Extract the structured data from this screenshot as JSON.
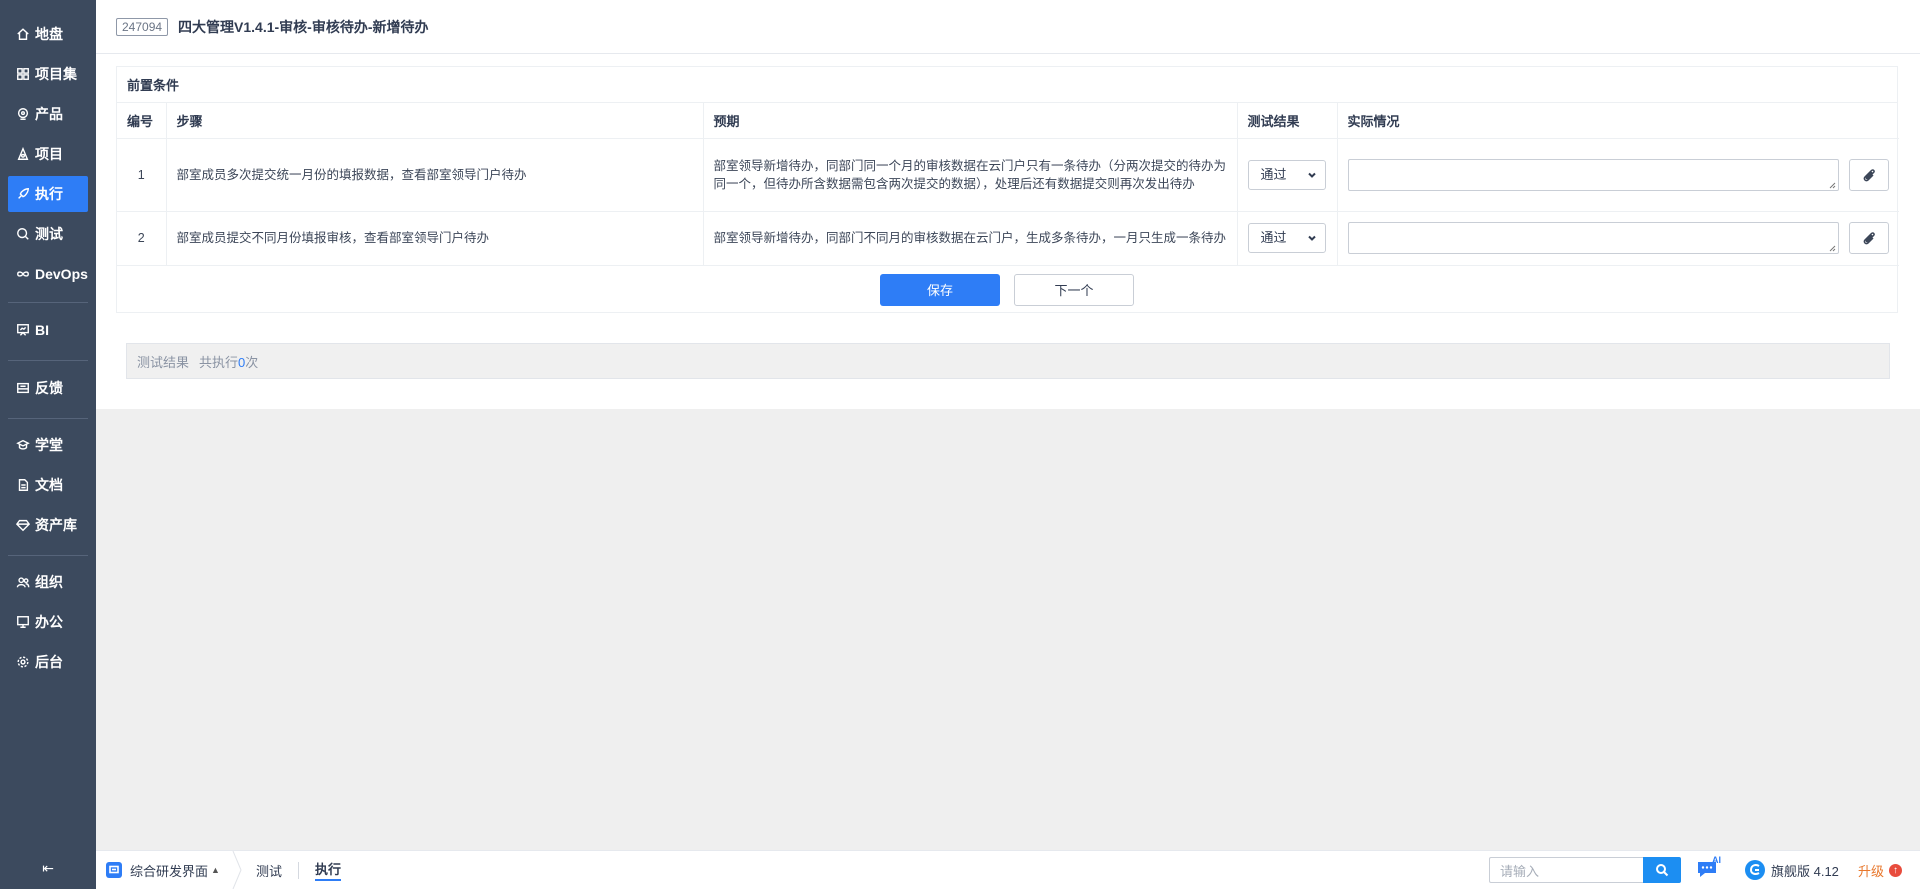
{
  "sidebar": {
    "items": [
      {
        "label": "地盘",
        "icon": "home-icon"
      },
      {
        "label": "项目集",
        "icon": "grid-icon"
      },
      {
        "label": "产品",
        "icon": "location-pin-icon"
      },
      {
        "label": "项目",
        "icon": "project-icon"
      },
      {
        "label": "执行",
        "icon": "rocket-icon",
        "active": true
      },
      {
        "label": "测试",
        "icon": "search-icon"
      },
      {
        "label": "DevOps",
        "icon": "infinity-icon"
      },
      {
        "label": "BI",
        "icon": "presentation-icon"
      },
      {
        "label": "反馈",
        "icon": "feedback-icon"
      },
      {
        "label": "学堂",
        "icon": "school-icon"
      },
      {
        "label": "文档",
        "icon": "document-icon"
      },
      {
        "label": "资产库",
        "icon": "diamond-icon"
      },
      {
        "label": "组织",
        "icon": "users-icon"
      },
      {
        "label": "办公",
        "icon": "monitor-icon"
      },
      {
        "label": "后台",
        "icon": "gear-icon"
      }
    ],
    "collapse_label": "⇤"
  },
  "header": {
    "case_id": "247094",
    "title": "四大管理V1.4.1-审核-审核待办-新增待办"
  },
  "case": {
    "precondition_label": "前置条件",
    "columns": [
      "编号",
      "步骤",
      "预期",
      "测试结果",
      "实际情况"
    ],
    "steps": [
      {
        "num": "1",
        "step": "部室成员多次提交统一月份的填报数据，查看部室领导门户待办",
        "expect": "部室领导新增待办，同部门同一个月的审核数据在云门户只有一条待办（分两次提交的待办为同一个，但待办所含数据需包含两次提交的数据），处理后还有数据提交则再次发出待办",
        "result": "通过",
        "actual": ""
      },
      {
        "num": "2",
        "step": "部室成员提交不同月份填报审核，查看部室领导门户待办",
        "expect": "部室领导新增待办，同部门不同月的审核数据在云门户，生成多条待办，一月只生成一条待办",
        "result": "通过",
        "actual": ""
      }
    ],
    "save_label": "保存",
    "next_label": "下一个"
  },
  "result_bar": {
    "label": "测试结果",
    "count_prefix": "共执行",
    "count": "0",
    "count_suffix": "次"
  },
  "bottombar": {
    "app_label": "综合研发界面",
    "crumbs": [
      "测试",
      "执行"
    ],
    "search_placeholder": "请输入",
    "ai_label": "AI",
    "version_label": "旗舰版 4.12",
    "upgrade_label": "升级"
  },
  "colors": {
    "sidebar_bg": "#3c4a5e",
    "accent": "#2e7df6",
    "upgrade": "#e8772b"
  }
}
